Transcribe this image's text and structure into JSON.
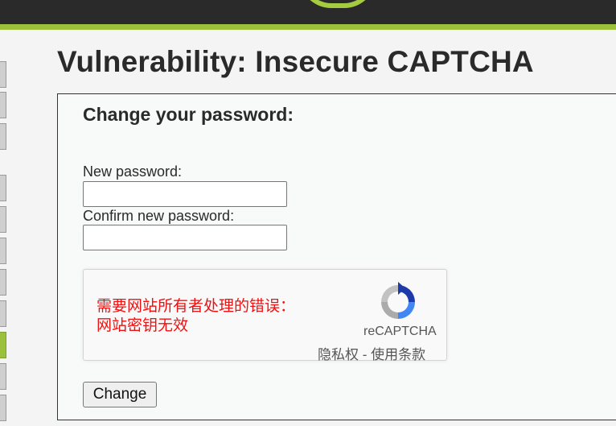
{
  "page": {
    "title": "Vulnerability: Insecure CAPTCHA"
  },
  "form": {
    "heading": "Change your password:",
    "new_password_label": "New password:",
    "new_password_value": "",
    "confirm_password_label": "Confirm new password:",
    "confirm_password_value": "",
    "submit_label": "Change"
  },
  "recaptcha": {
    "error_line1": "需要网站所有者处理的错误：",
    "error_line2": "网站密钥无效",
    "brand": "reCAPTCHA",
    "privacy_label": "隐私权",
    "separator": " - ",
    "terms_label": "使用条款"
  },
  "sidebar": {
    "active_index": 9
  },
  "colors": {
    "header_bg": "#2a2a2a",
    "accent_green": "#9bc13c",
    "error_red": "#ee1111"
  },
  "icons": [
    "logo-icon",
    "recaptcha-logo-icon"
  ]
}
